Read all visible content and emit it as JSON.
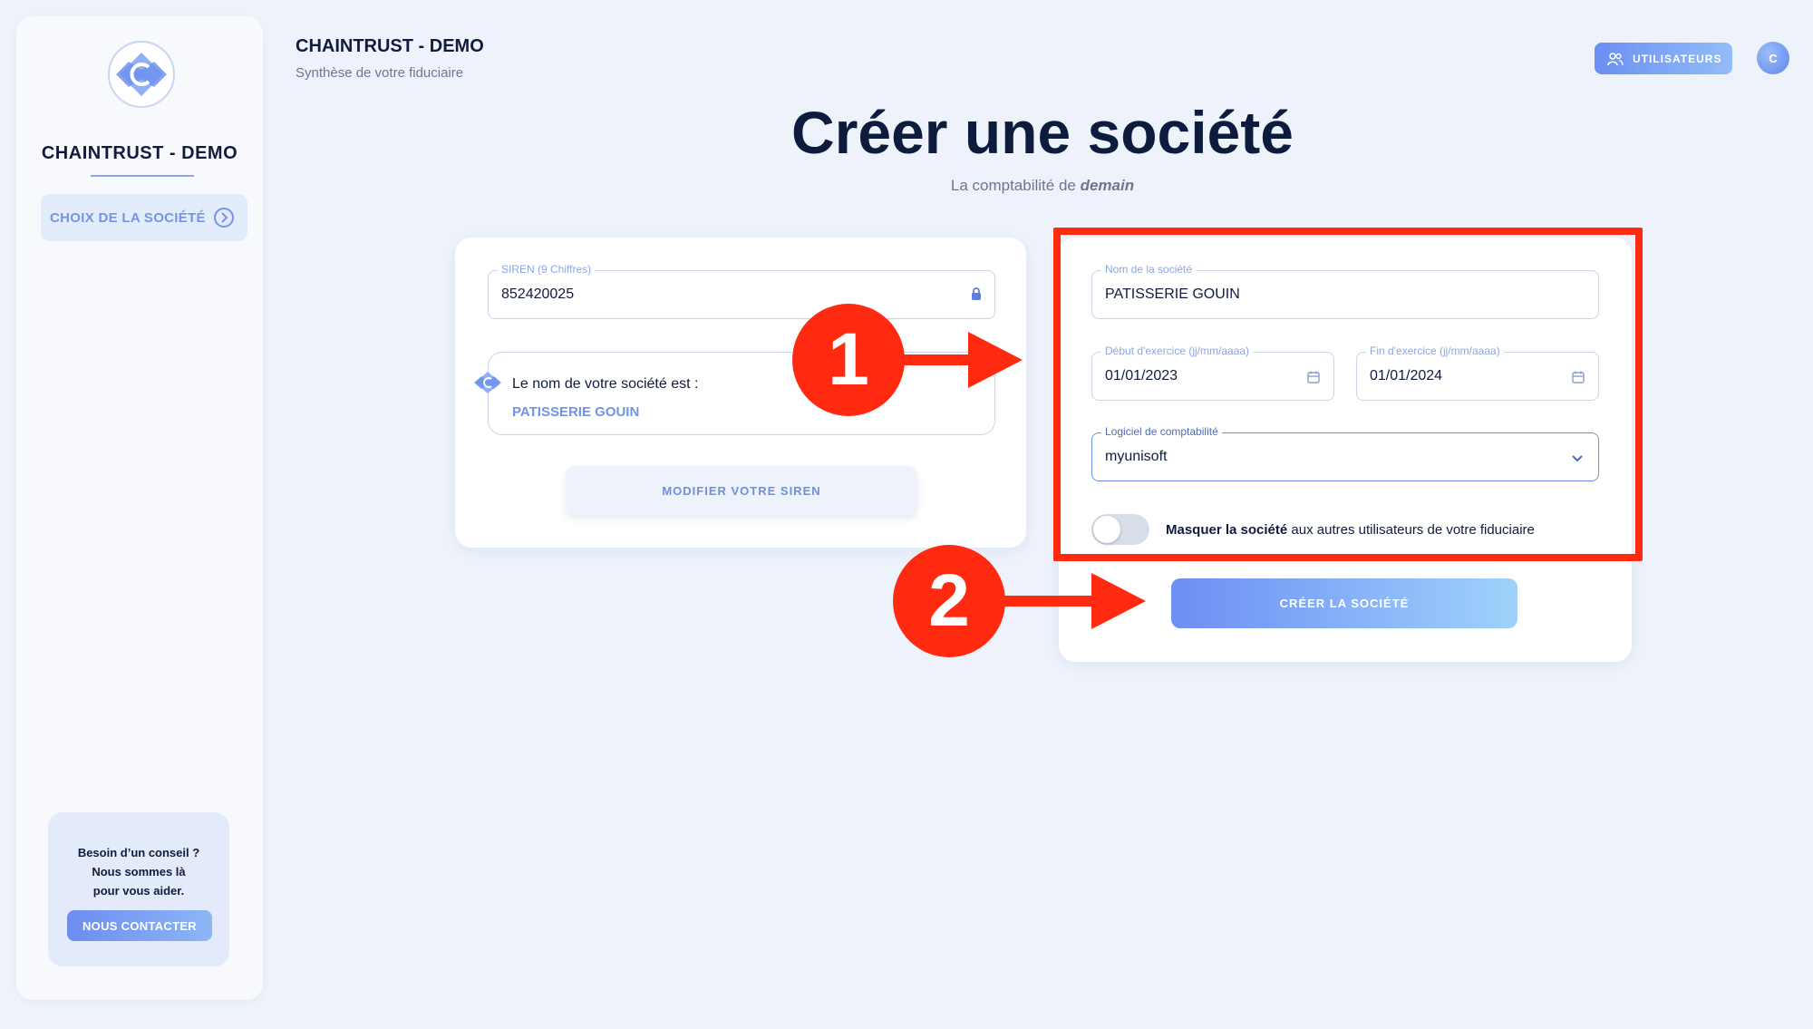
{
  "sidebar": {
    "title": "CHAINTRUST - DEMO",
    "nav_item": "CHOIX DE LA SOCIÉTÉ",
    "help_line1": "Besoin d’un conseil ?",
    "help_line2": "Nous sommes là",
    "help_line3": "pour vous aider.",
    "contact_button": "NOUS CONTACTER"
  },
  "header": {
    "title": "CHAINTRUST - DEMO",
    "subtitle": "Synthèse de votre fiduciaire",
    "users_button": "UTILISATEURS",
    "avatar_initial": "C"
  },
  "page": {
    "title": "Créer une société",
    "subtitle_prefix": "La comptabilité de ",
    "subtitle_emphasis": "demain"
  },
  "left_card": {
    "siren_label": "SIREN (9 Chiffres)",
    "siren_value": "852420025",
    "company_info_label": "Le nom de votre société est :",
    "company_info_value": "PATISSERIE GOUIN",
    "modify_button": "MODIFIER VOTRE SIREN"
  },
  "right_card": {
    "company_name_label": "Nom de la société",
    "company_name_value": "PATISSERIE GOUIN",
    "start_label": "Début d'exercice (jj/mm/aaaa)",
    "start_value": "01/01/2023",
    "end_label": "Fin d'exercice (jj/mm/aaaa)",
    "end_value": "01/01/2024",
    "software_label": "Logiciel de comptabilité",
    "software_value": "myunisoft",
    "toggle_bold": "Masquer la société",
    "toggle_rest": " aux autres utilisateurs de votre fiduciaire",
    "toggle_on": false,
    "create_button": "CRÉER LA SOCIÉTÉ"
  },
  "annotations": {
    "marker_1": "1",
    "marker_2": "2",
    "color": "#ff2a10"
  },
  "colors": {
    "background": "#eef3fb",
    "accent": "#6f93e8",
    "text_dark": "#0f1c3c"
  }
}
